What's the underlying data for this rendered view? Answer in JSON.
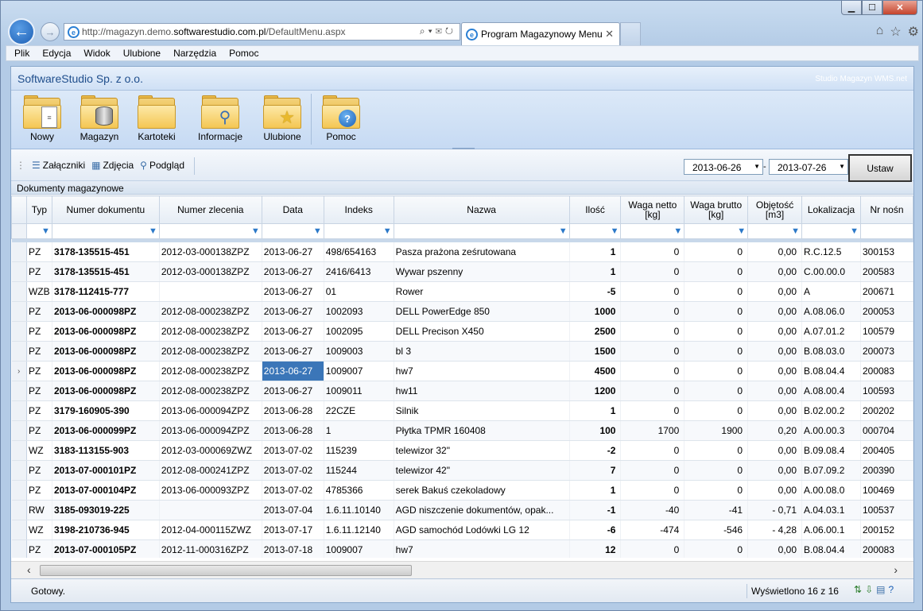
{
  "browser": {
    "url_prefix": "http://magazyn.demo.",
    "url_domain": "softwarestudio.com.pl",
    "url_suffix": "/DefaultMenu.aspx",
    "tab_title": "Program Magazynowy Menu",
    "menu": [
      "Plik",
      "Edycja",
      "Widok",
      "Ulubione",
      "Narzędzia",
      "Pomoc"
    ]
  },
  "app": {
    "brand": "SoftwareStudio Sp. z o.o.",
    "brand_right": "Studio Magazyn WMS.net",
    "ribbon": [
      {
        "label": "Nowy",
        "icon": "document-folder-icon"
      },
      {
        "label": "Magazyn",
        "icon": "database-folder-icon"
      },
      {
        "label": "Kartoteki",
        "icon": "folder-icon"
      },
      {
        "label": "Informacje",
        "icon": "magnifier-folder-icon"
      },
      {
        "label": "Ulubione",
        "icon": "star-folder-icon"
      },
      {
        "label": "Pomoc",
        "icon": "help-folder-icon"
      }
    ],
    "toolbar": {
      "attachments": "Załączniki",
      "photos": "Zdjęcia",
      "preview": "Podgląd",
      "date_from": "2013-06-26",
      "date_to": "2013-07-26",
      "set_button": "Ustaw"
    },
    "grid_title": "Dokumenty magazynowe",
    "columns": [
      "Typ",
      "Numer dokumentu",
      "Numer zlecenia",
      "Data",
      "Indeks",
      "Nazwa",
      "Ilość",
      "Waga netto [kg]",
      "Waga brutto [kg]",
      "Objętość [m3]",
      "Lokalizacja",
      "Nr nośn"
    ],
    "rows": [
      [
        "PZ",
        "3178-135515-451",
        "2012-03-000138ZPZ",
        "2013-06-27",
        "498/654163",
        "Pasza prażona ześrutowana",
        "1",
        "0",
        "0",
        "0,00",
        "R.C.12.5",
        "300153"
      ],
      [
        "PZ",
        "3178-135515-451",
        "2012-03-000138ZPZ",
        "2013-06-27",
        "2416/6413",
        "Wywar pszenny",
        "1",
        "0",
        "0",
        "0,00",
        "C.00.00.0",
        "200583"
      ],
      [
        "WZB",
        "3178-112415-777",
        "",
        "2013-06-27",
        "01",
        "Rower",
        "-5",
        "0",
        "0",
        "0,00",
        "A",
        "200671"
      ],
      [
        "PZ",
        "2013-06-000098PZ",
        "2012-08-000238ZPZ",
        "2013-06-27",
        "1002093",
        "DELL PowerEdge 850",
        "1000",
        "0",
        "0",
        "0,00",
        "A.08.06.0",
        "200053"
      ],
      [
        "PZ",
        "2013-06-000098PZ",
        "2012-08-000238ZPZ",
        "2013-06-27",
        "1002095",
        "DELL Precison X450",
        "2500",
        "0",
        "0",
        "0,00",
        "A.07.01.2",
        "100579"
      ],
      [
        "PZ",
        "2013-06-000098PZ",
        "2012-08-000238ZPZ",
        "2013-06-27",
        "1009003",
        "bl 3",
        "1500",
        "0",
        "0",
        "0,00",
        "B.08.03.0",
        "200073"
      ],
      [
        "PZ",
        "2013-06-000098PZ",
        "2012-08-000238ZPZ",
        "2013-06-27",
        "1009007",
        "hw7",
        "4500",
        "0",
        "0",
        "0,00",
        "B.08.04.4",
        "200083"
      ],
      [
        "PZ",
        "2013-06-000098PZ",
        "2012-08-000238ZPZ",
        "2013-06-27",
        "1009011",
        "hw11",
        "1200",
        "0",
        "0",
        "0,00",
        "A.08.00.4",
        "100593"
      ],
      [
        "PZ",
        "3179-160905-390",
        "2013-06-000094ZPZ",
        "2013-06-28",
        "22CZE",
        "Silnik",
        "1",
        "0",
        "0",
        "0,00",
        "B.02.00.2",
        "200202"
      ],
      [
        "PZ",
        "2013-06-000099PZ",
        "2013-06-000094ZPZ",
        "2013-06-28",
        "1",
        "Płytka TPMR 160408",
        "100",
        "1700",
        "1900",
        "0,20",
        "A.00.00.3",
        "000704"
      ],
      [
        "WZ",
        "3183-113155-903",
        "2012-03-000069ZWZ",
        "2013-07-02",
        "115239",
        "telewizor 32\"",
        "-2",
        "0",
        "0",
        "0,00",
        "B.09.08.4",
        "200405"
      ],
      [
        "PZ",
        "2013-07-000101PZ",
        "2012-08-000241ZPZ",
        "2013-07-02",
        "115244",
        "telewizor 42\"",
        "7",
        "0",
        "0",
        "0,00",
        "B.07.09.2",
        "200390"
      ],
      [
        "PZ",
        "2013-07-000104PZ",
        "2013-06-000093ZPZ",
        "2013-07-02",
        "4785366",
        "serek Bakuś czekoladowy",
        "1",
        "0",
        "0",
        "0,00",
        "A.00.08.0",
        "100469"
      ],
      [
        "RW",
        "3185-093019-225",
        "",
        "2013-07-04",
        "1.6.11.10140",
        "AGD niszczenie dokumentów, opak...",
        "-1",
        "-40",
        "-41",
        "- 0,71",
        "A.04.03.1",
        "100537"
      ],
      [
        "WZ",
        "3198-210736-945",
        "2012-04-000115ZWZ",
        "2013-07-17",
        "1.6.11.12140",
        "AGD samochód Lodówki LG 12",
        "-6",
        "-474",
        "-546",
        "- 4,28",
        "A.06.00.1",
        "200152"
      ],
      [
        "PZ",
        "2013-07-000105PZ",
        "2012-11-000316ZPZ",
        "2013-07-18",
        "1009007",
        "hw7",
        "12",
        "0",
        "0",
        "0,00",
        "B.08.04.4",
        "200083"
      ]
    ],
    "selected_row": 6,
    "selected_col": 3,
    "current_row_marker": "›",
    "status_left": "Gotowy.",
    "status_right": "Wyświetlono 16 z 16"
  }
}
